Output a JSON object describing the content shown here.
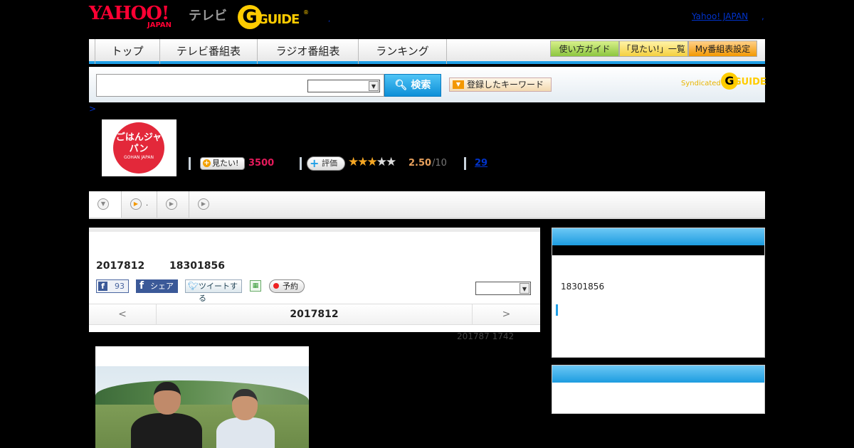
{
  "header": {
    "yahoo_logo_text": "YAHOO!",
    "yahoo_logo_sub": "JAPAN",
    "tv_label": "テレビ",
    "gguide_text": "GUIDE",
    "gguide_mark": "®",
    "yahoo_japan_link": "Yahoo! JAPAN"
  },
  "nav": {
    "tabs": [
      {
        "label": "トップ"
      },
      {
        "label": "テレビ番組表"
      },
      {
        "label": "ラジオ番組表"
      },
      {
        "label": "ランキング"
      }
    ],
    "buttons": [
      {
        "label": "使い方ガイド",
        "color": "#9acd32"
      },
      {
        "label": "「見たい!」一覧",
        "color": "#f5d040"
      },
      {
        "label": "My番組表設定",
        "color": "#f39800"
      }
    ]
  },
  "search": {
    "button_label": "検索",
    "keyword_label": "登録したキーワード",
    "syndicated_label": "Syndicated",
    "syndicated_logo": "GUIDE"
  },
  "breadcrumb": ">",
  "program": {
    "thumb_title": "ごはんジャパン",
    "thumb_sub": "GOHAN JAPAN",
    "want_label": "見たい!",
    "want_count": "3500",
    "rate_label": "評価",
    "rating": 2.5,
    "rating_value": "2.50",
    "rating_max": "/10",
    "review_count": "29"
  },
  "tabs": [
    {
      "icon": "chevron-down-icon"
    },
    {
      "icon": "play-icon",
      "label": "."
    },
    {
      "icon": "play-icon"
    },
    {
      "icon": "play-icon"
    }
  ],
  "episode": {
    "date": "2017812",
    "time": "18301856",
    "fb_like_count": "93",
    "fb_share_label": "シェア",
    "tweet_label": "ツイートする",
    "reserve_label": "予約",
    "prev": "<",
    "nav_date": "2017812",
    "next": ">",
    "updated": "201787  1742"
  },
  "side": {
    "time": "18301856"
  },
  "colors": {
    "accent_blue": "#1f9fe6",
    "want_pink": "#e61a5b",
    "rating_orange": "#e8a15d",
    "star": "#f5a623"
  }
}
